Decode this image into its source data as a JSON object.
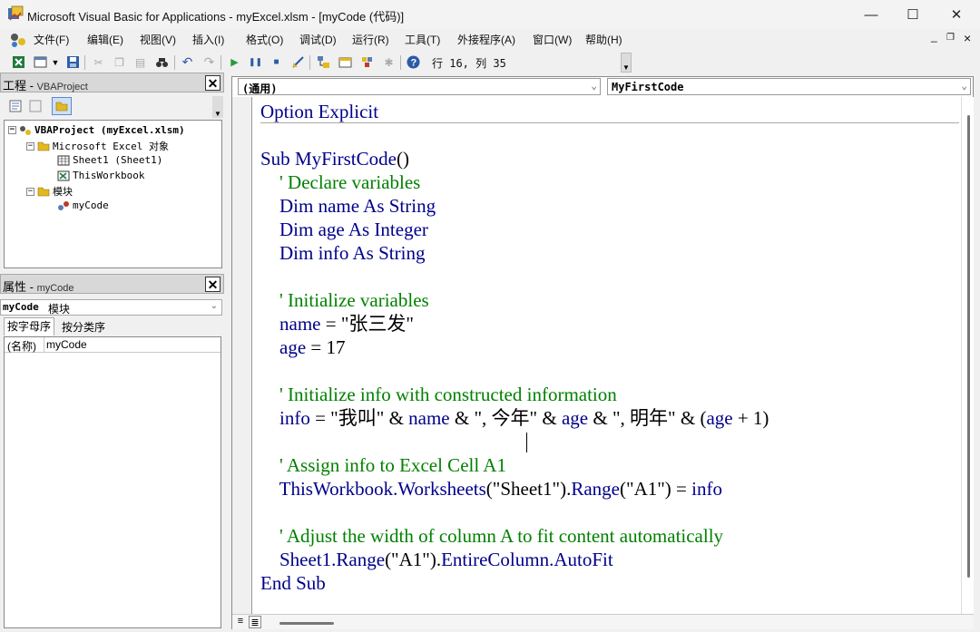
{
  "window": {
    "title": "Microsoft Visual Basic for Applications - myExcel.xlsm - [myCode (代码)]",
    "minimize": "—",
    "maximize": "☐",
    "close": "✕"
  },
  "menu": {
    "items": [
      "文件(F)",
      "编辑(E)",
      "视图(V)",
      "插入(I)",
      "格式(O)",
      "调试(D)",
      "运行(R)",
      "工具(T)",
      "外接程序(A)",
      "窗口(W)",
      "帮助(H)"
    ],
    "mdi_min": "_",
    "mdi_restore": "❐",
    "mdi_close": "×"
  },
  "toolbar": {
    "cursor_position": "行 16, 列 35"
  },
  "project_panel": {
    "title": "工程",
    "subtitle": "VBAProject",
    "tree": {
      "root": "VBAProject (myExcel.xlsm)",
      "excel_objects": "Microsoft Excel 对象",
      "sheet1": "Sheet1 (Sheet1)",
      "thisworkbook": "ThisWorkbook",
      "modules": "模块",
      "mycode": "myCode"
    }
  },
  "properties_panel": {
    "title": "属性",
    "subtitle": "myCode",
    "object_name": "myCode",
    "object_type": "模块",
    "tab_alpha": "按字母序",
    "tab_category": "按分类序",
    "property_name": "(名称)",
    "property_value": "myCode"
  },
  "code_window": {
    "object_combo": "(通用)",
    "procedure_combo": "MyFirstCode",
    "lines": {
      "l1": "Option Explicit",
      "l3a": "Sub ",
      "l3b": "MyFirstCode",
      "l3c": "()",
      "l4": "    ' Declare variables",
      "l5a": "    Dim ",
      "l5b": "name",
      "l5c": " As String",
      "l6a": "    Dim ",
      "l6b": "age",
      "l6c": " As Integer",
      "l7a": "    Dim ",
      "l7b": "info",
      "l7c": " As String",
      "l9": "    ' Initialize variables",
      "l10a": "    name",
      "l10b": " = \"张三发\"",
      "l11a": "    age",
      "l11b": " = 17",
      "l13": "    ' Initialize info with constructed information",
      "l14a": "    info",
      "l14b": " = \"我叫\" & ",
      "l14c": "name",
      "l14d": " & \", 今年\" & ",
      "l14e": "age",
      "l14f": " & \", 明年\" & (",
      "l14g": "age",
      "l14h": " + 1)",
      "l16": "    ' Assign info to Excel Cell A1",
      "l17a": "    ThisWorkbook.Worksheets",
      "l17b": "(\"Sheet1\").",
      "l17c": "Range",
      "l17d": "(\"A1\") = ",
      "l17e": "info",
      "l19": "    ' Adjust the width of column A to fit content automatically",
      "l20a": "    Sheet1.Range",
      "l20b": "(\"A1\").",
      "l20c": "EntireColumn.AutoFit",
      "l21": "End Sub"
    }
  }
}
